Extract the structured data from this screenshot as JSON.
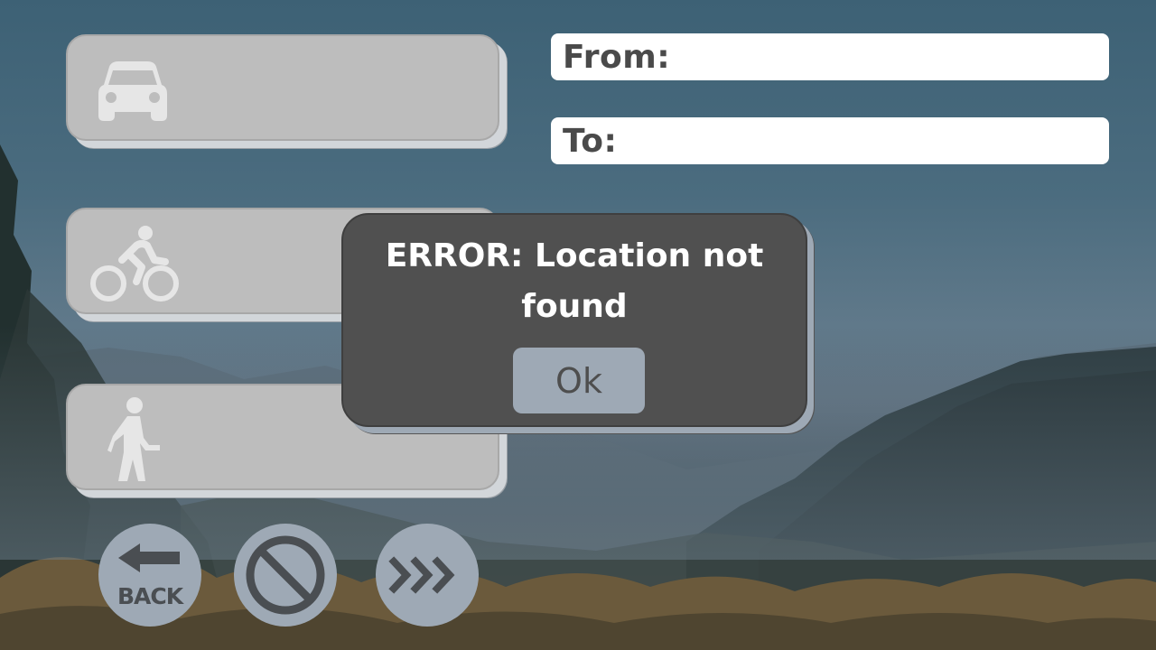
{
  "modes": [
    {
      "id": "car",
      "icon": "car-icon"
    },
    {
      "id": "bike",
      "icon": "cyclist-icon"
    },
    {
      "id": "walk",
      "icon": "pedestrian-icon"
    }
  ],
  "route": {
    "from_label": "From:",
    "from_value": "",
    "to_label": "To:",
    "to_value": ""
  },
  "controls": {
    "back_label": "BACK",
    "back_icon": "arrow-left-icon",
    "cancel_icon": "prohibited-icon",
    "forward_icon": "triple-chevron-right-icon"
  },
  "dialog": {
    "message": "ERROR: Location not found",
    "ok_label": "Ok"
  },
  "colors": {
    "button_gray": "#bdbdbd",
    "dialog_bg": "#505050",
    "accent_blue_gray": "#9ea9b5",
    "field_bg": "#ffffff",
    "label_text": "#4a4a4a"
  }
}
